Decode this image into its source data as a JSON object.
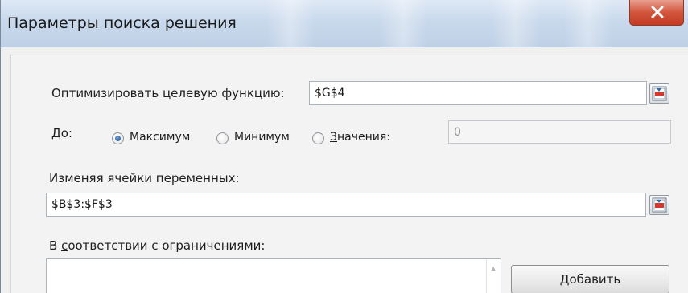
{
  "window": {
    "title": "Параметры поиска решения"
  },
  "objective": {
    "label": "Оптимизировать целевую функцию:",
    "value": "$G$4"
  },
  "to": {
    "label": "До:",
    "options": [
      {
        "label": "Максимум",
        "checked": true
      },
      {
        "label": "Минимум",
        "checked": false
      },
      {
        "label": "Значения:",
        "checked": false
      }
    ],
    "value_field": "0"
  },
  "variables": {
    "label": "Изменяя ячейки переменных:",
    "value": "$B$3:$F$3"
  },
  "constraints": {
    "label": "В соответствии с ограничениями:",
    "add_button": "Добавить"
  },
  "colors": {
    "close_button": "#c13c24",
    "title_bar": "#c9d9ec",
    "radio_selected": "#1f4f8f"
  }
}
